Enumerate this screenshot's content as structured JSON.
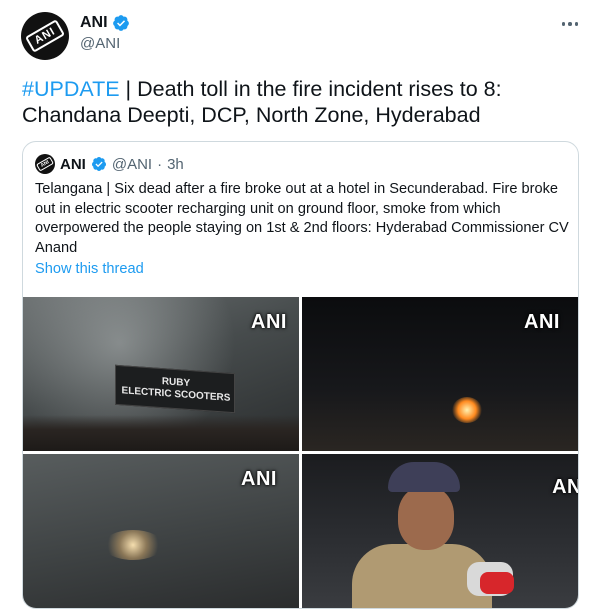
{
  "tweet": {
    "author": {
      "display_name": "ANI",
      "handle": "@ANI",
      "avatar_text": "ANI",
      "verified_icon": "verified-badge-icon"
    },
    "more_icon": "more-options-icon",
    "text_hashtag": "#UPDATE",
    "text_body": " | Death toll in the fire incident rises to 8: Chandana Deepti, DCP, North Zone, Hyderabad"
  },
  "quote": {
    "display_name": "ANI",
    "handle": "@ANI",
    "separator": "·",
    "time": "3h",
    "text": "Telangana | Six dead after a fire broke out at a hotel in Secunderabad. Fire broke out in electric scooter recharging unit on ground floor, smoke from which overpowered the people staying on 1st & 2nd floors: Hyderabad Commissioner CV Anand",
    "show_thread": "Show this thread",
    "media": [
      {
        "watermark": "ANI",
        "sign_line_1": "RUBY",
        "sign_line_2": "ELECTRIC SCOOTERS"
      },
      {
        "watermark": "ANI"
      },
      {
        "watermark": "ANI"
      },
      {
        "watermark": "AN"
      }
    ]
  },
  "colors": {
    "accent": "#1d9bf0",
    "text": "#0f1419",
    "muted": "#536471",
    "border": "#cfd9de"
  }
}
